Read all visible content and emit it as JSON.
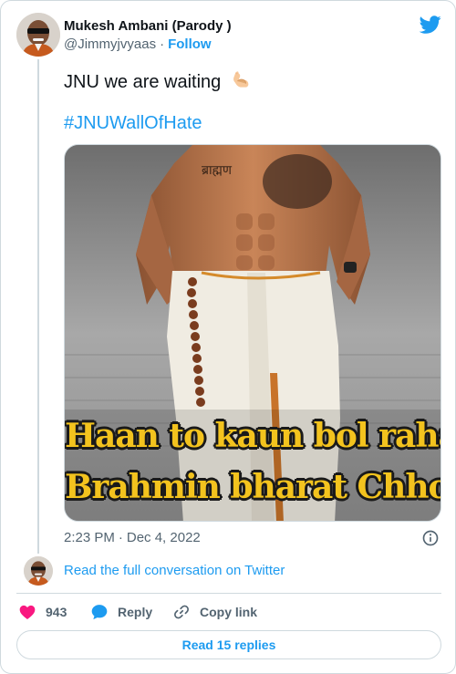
{
  "author": {
    "name": "Mukesh Ambani (Parody )",
    "handle": "@Jimmyjvyaas",
    "separator": "·",
    "follow_label": "Follow"
  },
  "tweet": {
    "text": "JNU we are waiting",
    "emoji": "flexed-biceps-emoji",
    "hashtag": "#JNUWallOfHate",
    "image_caption": {
      "line1": "Haan to kaun bol raha tha",
      "line2": "Brahmin bharat Chhod do?"
    },
    "image_tattoo_text": "ब्राह्मण",
    "time": "2:23 PM",
    "separator": "·",
    "date": "Dec 4, 2022"
  },
  "conversation": {
    "link_label": "Read the full conversation on Twitter"
  },
  "actions": {
    "like_count": "943",
    "reply_label": "Reply",
    "copy_label": "Copy link"
  },
  "replies": {
    "button_label": "Read 15 replies"
  },
  "colors": {
    "brand": "#1d9bf0",
    "like": "#f91880",
    "text": "#0f1419",
    "secondary": "#536471",
    "border": "#cfd9de",
    "caption": "#f3c31e"
  },
  "icons": {
    "logo": "twitter-bird-icon",
    "info": "info-icon",
    "like": "heart-icon",
    "reply": "speech-bubble-icon",
    "copy": "link-icon"
  }
}
